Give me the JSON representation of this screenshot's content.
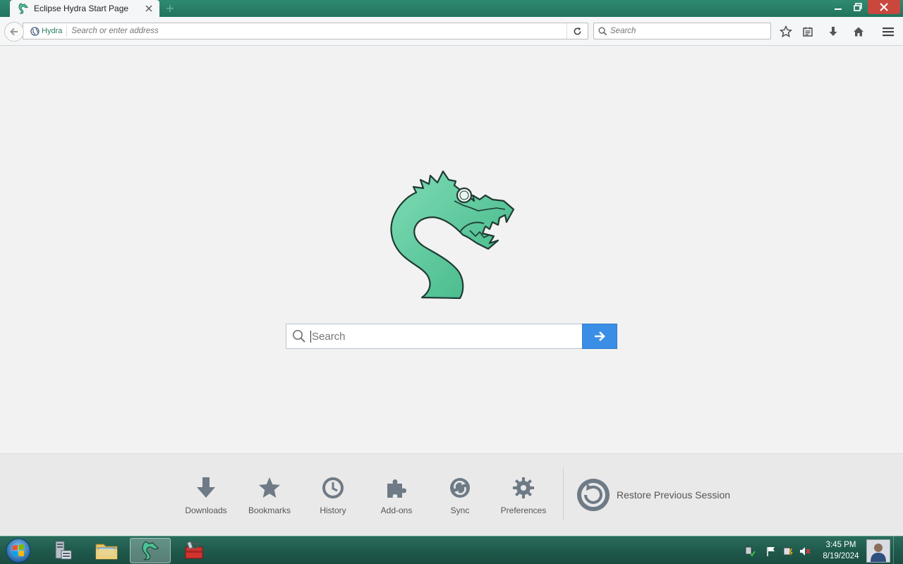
{
  "browser": {
    "tab": {
      "title": "Eclipse Hydra Start Page",
      "favicon": "hydra-icon"
    },
    "window_controls": [
      "minimize",
      "maximize",
      "close"
    ],
    "identity_label": "Hydra",
    "url_placeholder": "Search or enter address",
    "search_placeholder": "Search",
    "toolbar_icons": [
      "star-icon",
      "reading-list-icon",
      "download-icon",
      "home-icon",
      "menu-icon"
    ]
  },
  "start_page": {
    "logo": "hydra-logo",
    "search_placeholder": "Search",
    "accent_color": "#3b8ee5",
    "launcher": [
      {
        "label": "Downloads",
        "icon": "download-icon"
      },
      {
        "label": "Bookmarks",
        "icon": "star-icon"
      },
      {
        "label": "History",
        "icon": "clock-icon"
      },
      {
        "label": "Add-ons",
        "icon": "puzzle-icon"
      },
      {
        "label": "Sync",
        "icon": "sync-icon"
      },
      {
        "label": "Preferences",
        "icon": "gear-icon"
      }
    ],
    "restore_label": "Restore Previous Session"
  },
  "taskbar": {
    "clock_time": "3:45 PM",
    "clock_date": "8/19/2024",
    "apps": [
      "server-manager-icon",
      "file-explorer-icon",
      "hydra-browser-icon",
      "toolbox-icon"
    ],
    "tray_icons": [
      "network-icon",
      "flag-icon",
      "power-icon",
      "speaker-muted-icon"
    ],
    "theme_color": "#23735e"
  }
}
